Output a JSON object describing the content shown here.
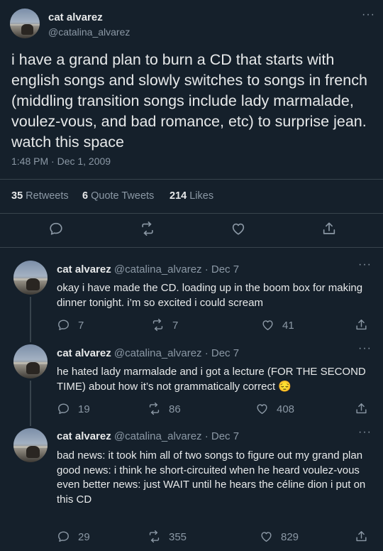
{
  "main_tweet": {
    "author_name": "cat alvarez",
    "author_handle": "@catalina_alvarez",
    "text": "i have a grand plan to burn a CD that starts with english songs and slowly switches to songs in french (middling transition songs include lady marmalade, voulez-vous, and bad romance, etc) to surprise jean. watch this space",
    "timestamp": "1:48 PM · Dec 1, 2009",
    "stats": {
      "retweets_count": "35",
      "retweets_label": "Retweets",
      "quotes_count": "6",
      "quotes_label": "Quote Tweets",
      "likes_count": "214",
      "likes_label": "Likes"
    },
    "actions": [
      "reply-icon",
      "retweet-icon",
      "like-icon",
      "share-icon"
    ]
  },
  "replies": [
    {
      "author_name": "cat alvarez",
      "meta": "@catalina_alvarez · Dec 7",
      "text": "okay i have made the CD. loading up in the boom box for making dinner tonight. i’m so excited i could scream",
      "replies": "7",
      "retweets": "7",
      "likes": "41"
    },
    {
      "author_name": "cat alvarez",
      "meta": "@catalina_alvarez · Dec 7",
      "text": "he hated lady marmalade and i got a lecture (FOR THE SECOND TIME) about how it’s not grammatically correct 😔",
      "replies": "19",
      "retweets": "86",
      "likes": "408"
    },
    {
      "author_name": "cat alvarez",
      "meta": "@catalina_alvarez · Dec 7",
      "text": "bad news: it took him all of two songs to figure out my grand plan\ngood news: i think he short-circuited when he heard voulez-vous\neven better news: just WAIT until he hears the céline dion i put on this CD",
      "replies": "29",
      "retweets": "355",
      "likes": "829"
    }
  ],
  "more_icon": "···",
  "colors": {
    "background": "#15202b",
    "text": "#e7e9ea",
    "muted": "#8b98a5",
    "divider": "#38444d"
  }
}
